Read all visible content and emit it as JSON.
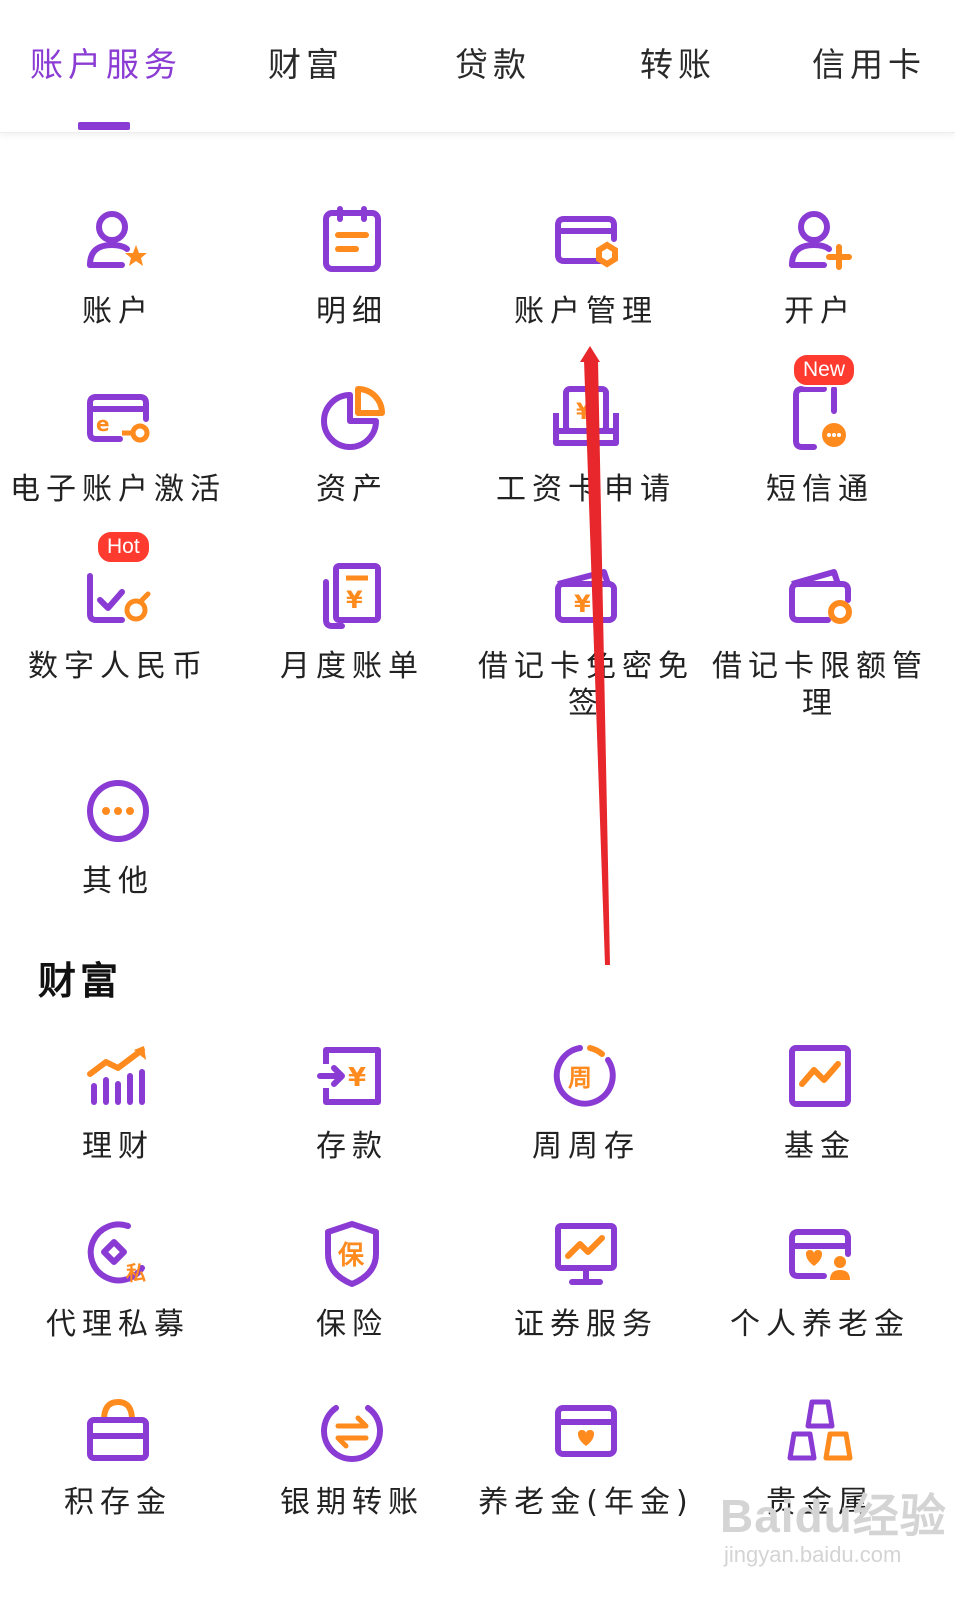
{
  "tabs": [
    {
      "label": "账户服务",
      "active": true
    },
    {
      "label": "财富",
      "active": false
    },
    {
      "label": "贷款",
      "active": false
    },
    {
      "label": "转账",
      "active": false
    },
    {
      "label": "信用卡",
      "active": false
    }
  ],
  "account_services": [
    {
      "label": "账户",
      "icon": "user-star-icon"
    },
    {
      "label": "明细",
      "icon": "notepad-icon"
    },
    {
      "label": "账户管理",
      "icon": "card-gear-icon"
    },
    {
      "label": "开户",
      "icon": "user-plus-icon"
    },
    {
      "label": "电子账户激活",
      "icon": "e-card-key-icon"
    },
    {
      "label": "资产",
      "icon": "pie-chart-icon"
    },
    {
      "label": "工资卡申请",
      "icon": "salary-card-icon"
    },
    {
      "label": "短信通",
      "icon": "phone-message-icon",
      "badge": "New"
    },
    {
      "label": "数字人民币",
      "icon": "digital-rmb-icon",
      "badge": "Hot"
    },
    {
      "label": "月度账单",
      "icon": "bill-icon"
    },
    {
      "label": "借记卡免密免签",
      "icon": "card-wallet-icon"
    },
    {
      "label": "借记卡限额管理",
      "icon": "card-limit-icon"
    },
    {
      "label": "其他",
      "icon": "more-icon"
    }
  ],
  "wealth_title": "财富",
  "wealth": [
    {
      "label": "理财",
      "icon": "bar-growth-icon"
    },
    {
      "label": "存款",
      "icon": "deposit-icon"
    },
    {
      "label": "周周存",
      "icon": "weekly-deposit-icon"
    },
    {
      "label": "基金",
      "icon": "fund-chart-icon"
    },
    {
      "label": "代理私募",
      "icon": "private-fund-icon"
    },
    {
      "label": "保险",
      "icon": "insurance-shield-icon"
    },
    {
      "label": "证券服务",
      "icon": "securities-monitor-icon"
    },
    {
      "label": "个人养老金",
      "icon": "pension-card-icon"
    },
    {
      "label": "积存金",
      "icon": "gold-bag-icon"
    },
    {
      "label": "银期转账",
      "icon": "exchange-icon"
    },
    {
      "label": "养老金(年金)",
      "icon": "annuity-card-icon"
    },
    {
      "label": "贵金属",
      "icon": "precious-metal-icon"
    }
  ],
  "watermark": {
    "main": "Baidu经验",
    "sub": "jingyan.baidu.com"
  },
  "colors": {
    "accent": "#8a3bd4",
    "orange": "#ff8a1e",
    "badge": "#ff3a2f",
    "arrow": "#e8272c"
  }
}
